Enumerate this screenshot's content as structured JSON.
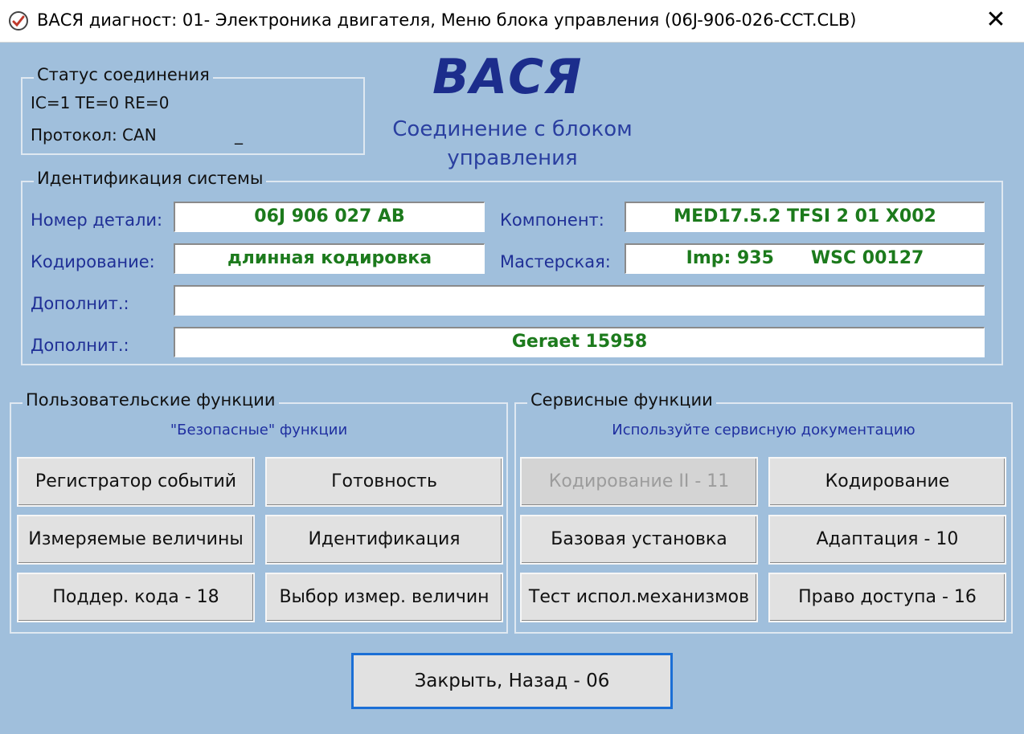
{
  "window": {
    "title": "ВАСЯ диагност: 01- Электроника двигателя,  Меню блока управления (06J-906-026-CCT.CLB)",
    "close_glyph": "✕"
  },
  "status": {
    "group_label": "Статус соединения",
    "line1": "IC=1  TE=0   RE=0",
    "protocol": "Протокол: CAN",
    "cursor": "_"
  },
  "header": {
    "logo": "ВАСЯ",
    "subtitle": "Соединение с блоком управления"
  },
  "identification": {
    "group_label": "Идентификация системы",
    "part_number_label": "Номер детали:",
    "part_number": "06J 906 027 AB",
    "component_label": "Компонент:",
    "component": "MED17.5.2 TFSI 2 01 X002",
    "coding_label": "Кодирование:",
    "coding": "длинная кодировка",
    "workshop_label": "Мастерская:",
    "workshop": "Imp: 935      WSC 00127",
    "extra1_label": "Дополнит.:",
    "extra1": "",
    "extra2_label": "Дополнит.:",
    "extra2": "Geraet 15958"
  },
  "user_functions": {
    "group_label": "Пользовательские функции",
    "hint": "\"Безопасные\" функции",
    "buttons": {
      "fault_codes": "Регистратор событий",
      "readiness": "Готовность",
      "measuring_blocks": "Измеряемые величины",
      "identification": "Идентификация",
      "supported_codes": "Поддер. кода - 18",
      "select_measurements": "Выбор измер. величин"
    }
  },
  "service_functions": {
    "group_label": "Сервисные функции",
    "hint": "Используйте сервисную документацию",
    "buttons": {
      "coding_ii": "Кодирование II - 11",
      "coding": "Кодирование",
      "basic_settings": "Базовая установка",
      "adaptation": "Адаптация - 10",
      "output_tests": "Тест испол.механизмов",
      "access": "Право доступа - 16"
    }
  },
  "footer": {
    "close_back": "Закрыть, Назад - 06"
  },
  "colors": {
    "background": "#a0bfdc",
    "logo": "#1c2d8c",
    "field_text": "#1c7a1c",
    "label_text": "#1f2f96",
    "focus_border": "#1b6fd6"
  }
}
